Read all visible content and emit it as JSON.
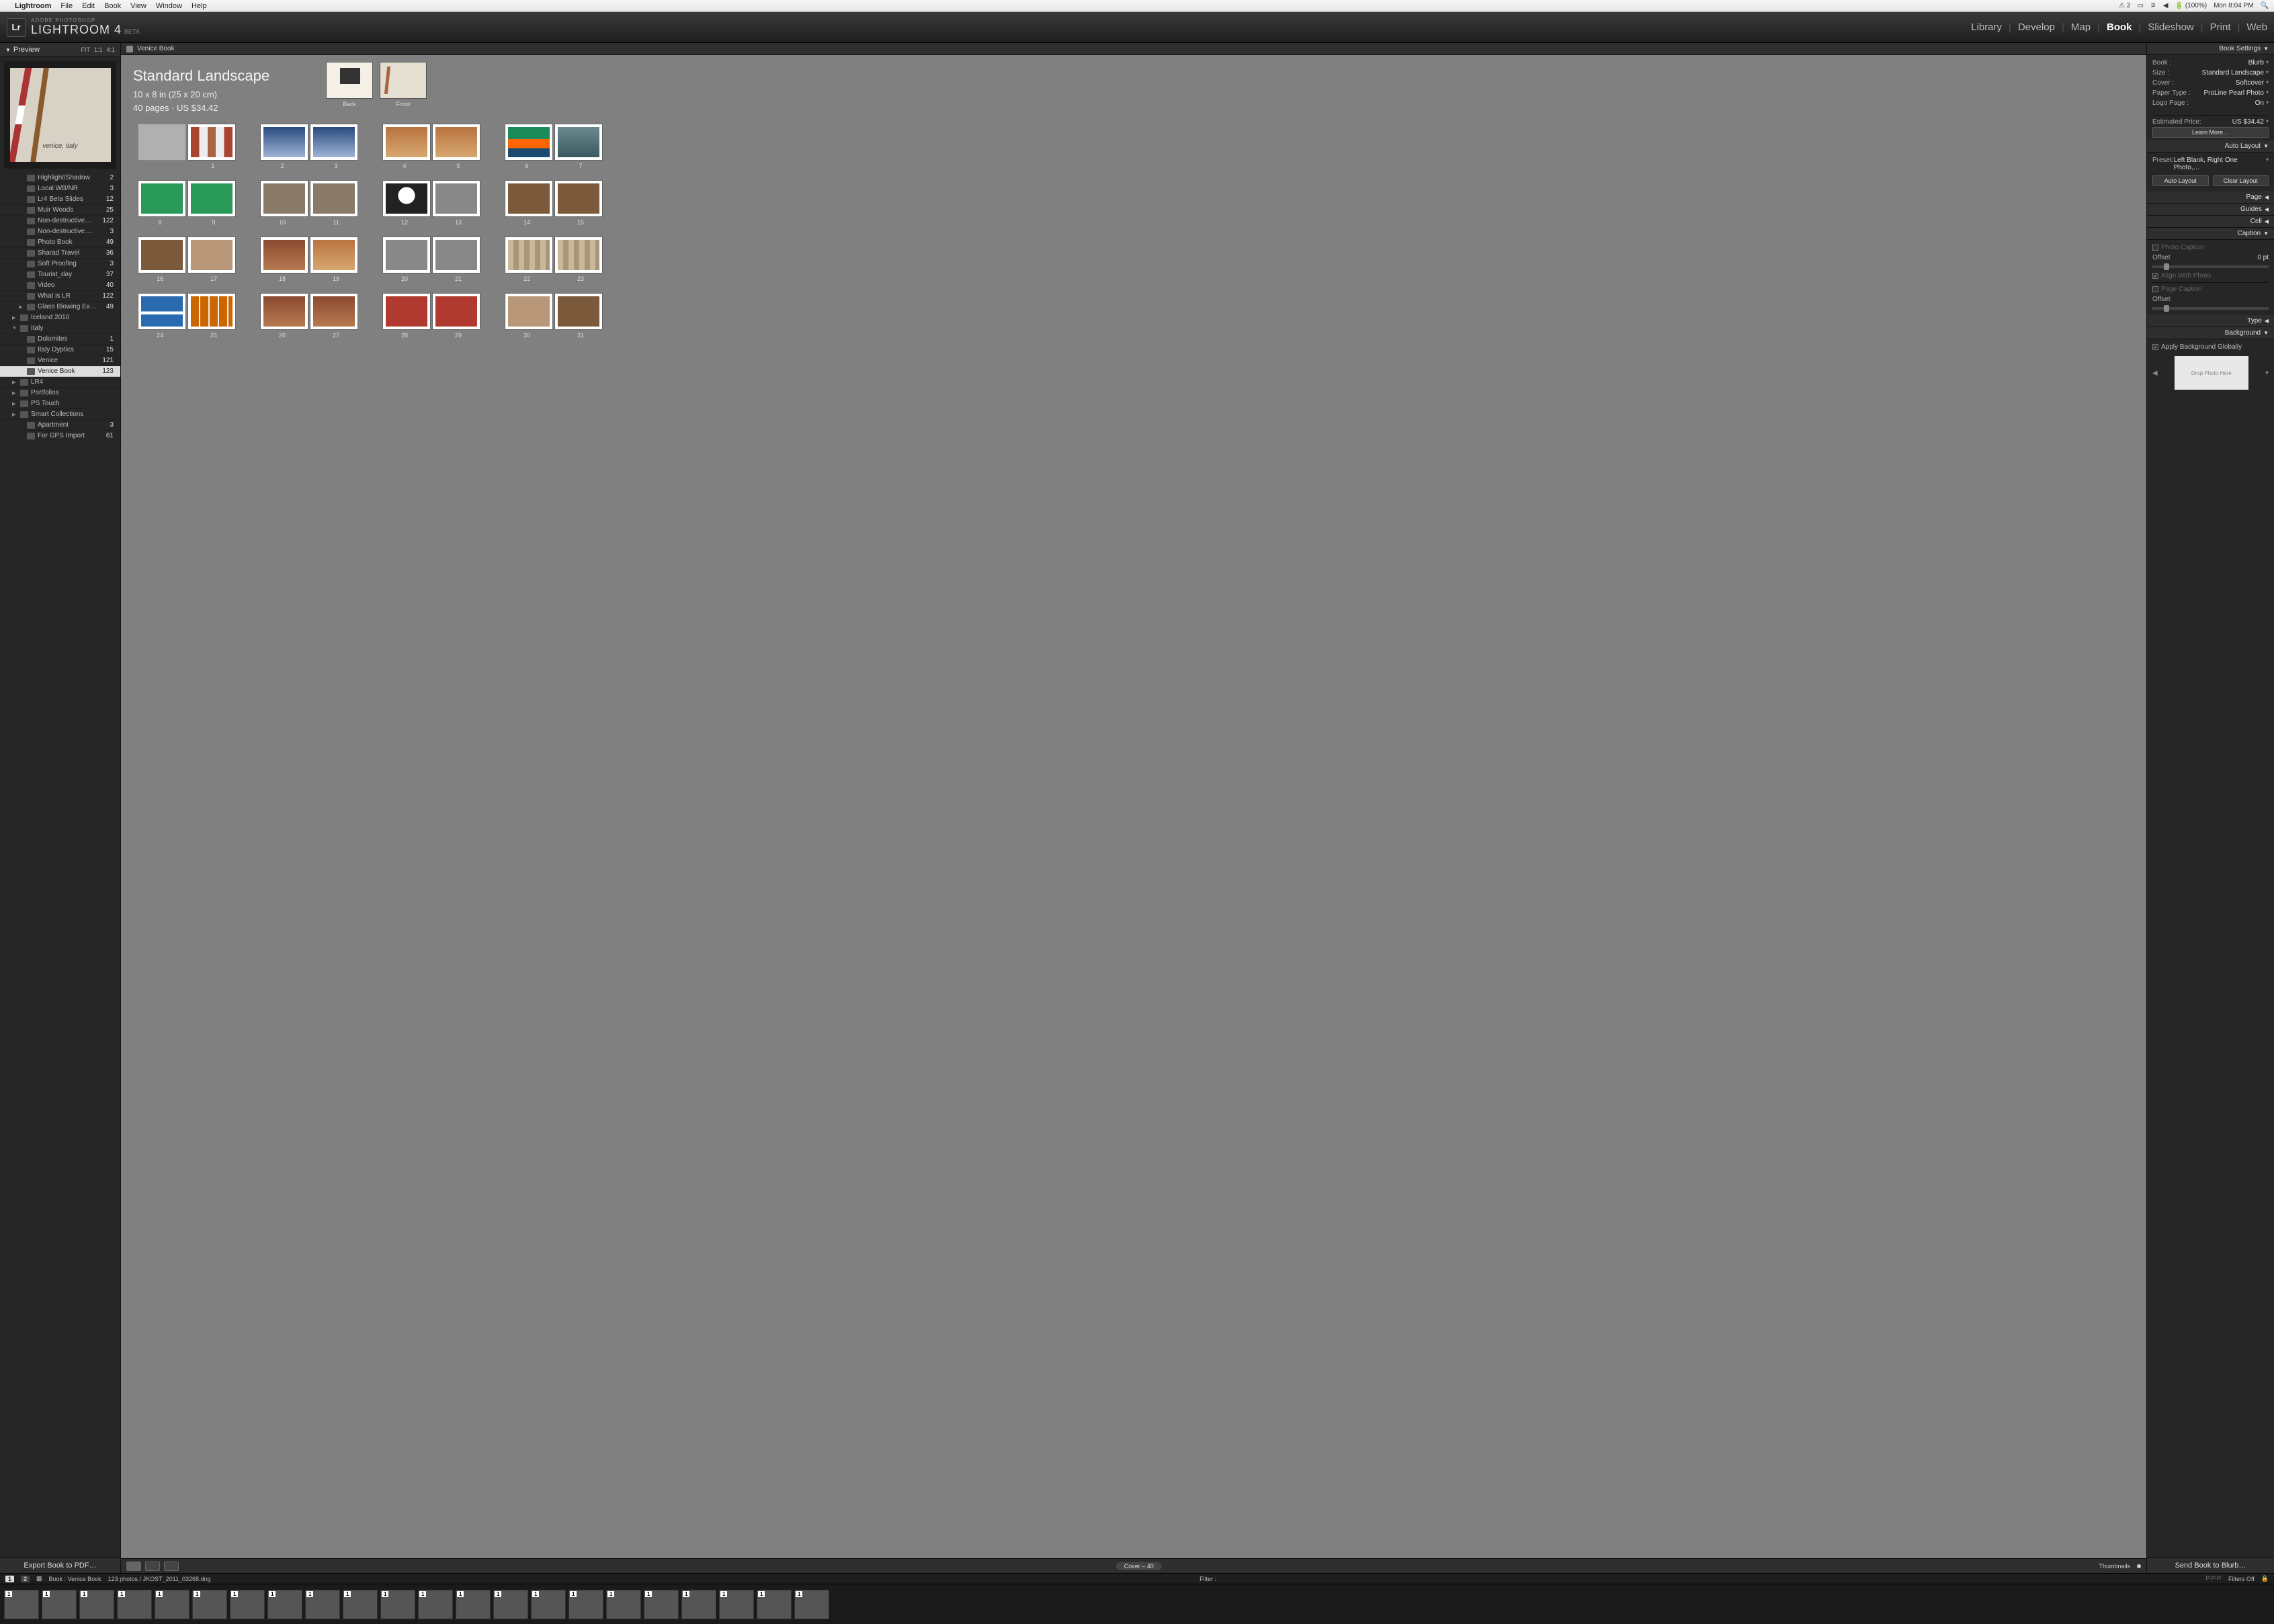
{
  "mac_menu": {
    "apple": "",
    "app": "Lightroom",
    "items": [
      "File",
      "Edit",
      "Book",
      "View",
      "Window",
      "Help"
    ],
    "right": {
      "notif": "2",
      "battery": "(100%)",
      "clock": "Mon 8:04 PM"
    }
  },
  "header": {
    "badge": "Lr",
    "sup": "ADOBE PHOTOSHOP",
    "main": "LIGHTROOM 4",
    "beta": "BETA",
    "modules": [
      "Library",
      "Develop",
      "Map",
      "Book",
      "Slideshow",
      "Print",
      "Web"
    ],
    "active_module": "Book"
  },
  "left": {
    "preview_title": "Preview",
    "zoom": [
      "FIT",
      "1:1",
      "4:1"
    ],
    "preview_caption": "venice, italy",
    "collections": [
      {
        "name": "Highlight/Shadow",
        "count": 2,
        "nest": 1
      },
      {
        "name": "Local WB/NR",
        "count": 3,
        "nest": 1
      },
      {
        "name": "Lr4 Beta Slides",
        "count": 12,
        "nest": 1
      },
      {
        "name": "Muir Woods",
        "count": 25,
        "nest": 1
      },
      {
        "name": "Non-destructive…",
        "count": 122,
        "nest": 1
      },
      {
        "name": "Non-destructive…",
        "count": 3,
        "nest": 1
      },
      {
        "name": "Photo Book",
        "count": 49,
        "nest": 1
      },
      {
        "name": "Sharad Travel",
        "count": 36,
        "nest": 1
      },
      {
        "name": "Soft Proofing",
        "count": 3,
        "nest": 1
      },
      {
        "name": "Tourist_day",
        "count": 37,
        "nest": 1
      },
      {
        "name": "Video",
        "count": 40,
        "nest": 1
      },
      {
        "name": "What is LR",
        "count": 122,
        "nest": 1
      },
      {
        "name": "Glass Blowing Ex…",
        "count": 49,
        "nest": 1,
        "tri": "▶"
      },
      {
        "name": "Iceland 2010",
        "count": "",
        "nest": 0,
        "tri": "▶"
      },
      {
        "name": "Italy",
        "count": "",
        "nest": 0,
        "tri": "▼"
      },
      {
        "name": "Dolomites",
        "count": 1,
        "nest": 1
      },
      {
        "name": "Italy Dyptics",
        "count": 15,
        "nest": 1
      },
      {
        "name": "Venice",
        "count": 121,
        "nest": 1
      },
      {
        "name": "Venice Book",
        "count": 123,
        "nest": 1,
        "sel": true
      },
      {
        "name": "LR4",
        "count": "",
        "nest": 0,
        "tri": "▶"
      },
      {
        "name": "Portfolios",
        "count": "",
        "nest": 0,
        "tri": "▶"
      },
      {
        "name": "PS Touch",
        "count": "",
        "nest": 0,
        "tri": "▶"
      },
      {
        "name": "Smart Collections",
        "count": "",
        "nest": 0,
        "tri": "▶"
      },
      {
        "name": "Apartment",
        "count": 3,
        "nest": 1
      },
      {
        "name": "For GPS Import",
        "count": 61,
        "nest": 1
      }
    ],
    "export_btn": "Export Book to PDF…"
  },
  "center": {
    "doc_title": "Venice Book",
    "hero": {
      "title": "Standard Landscape",
      "size": "10 x 8 in (25 x 20 cm)",
      "summary": "40 pages · US $34.42",
      "back": "Back",
      "front": "Front"
    },
    "pages": [
      1,
      2,
      3,
      4,
      5,
      6,
      7,
      8,
      9,
      10,
      11,
      12,
      13,
      14,
      15,
      16,
      17,
      18,
      19,
      20,
      21,
      22,
      23,
      24,
      25,
      26,
      27,
      28,
      29,
      30,
      31
    ],
    "toolbar": {
      "indicator": "Cover – 40",
      "thumb_lbl": "Thumbnails"
    }
  },
  "right": {
    "book_settings": {
      "hdr": "Book Settings",
      "rows": [
        {
          "k": "Book :",
          "v": "Blurb"
        },
        {
          "k": "Size :",
          "v": "Standard Landscape"
        },
        {
          "k": "Cover :",
          "v": "Softcover"
        },
        {
          "k": "Paper Type :",
          "v": "ProLine Pearl Photo"
        },
        {
          "k": "Logo Page :",
          "v": "On"
        }
      ],
      "price_k": "Estimated Price:",
      "price_v": "US $34.42",
      "learn": "Learn More…"
    },
    "auto_layout": {
      "hdr": "Auto Layout",
      "preset_k": "Preset:",
      "preset_v": "Left Blank, Right One Photo,…",
      "btn_auto": "Auto Layout",
      "btn_clear": "Clear Layout"
    },
    "collapsed": [
      "Page",
      "Guides",
      "Cell"
    ],
    "caption": {
      "hdr": "Caption",
      "photo_cap": "Photo Caption",
      "offset": "Offset",
      "offset_val": "0 pt",
      "align": "Align With Photo",
      "page_cap": "Page Caption"
    },
    "type_hdr": "Type",
    "background": {
      "hdr": "Background",
      "apply": "Apply Background Globally",
      "drop": "Drop Photo Here"
    },
    "send_btn": "Send Book to Blurb…"
  },
  "status": {
    "pages": [
      "1",
      "2"
    ],
    "crumb": "Book : Venice Book",
    "count": "123 photos / JKOST_2011_03268.dng",
    "filter": "Filter :",
    "filters_off": "Filters Off"
  },
  "filmstrip_count": 22
}
